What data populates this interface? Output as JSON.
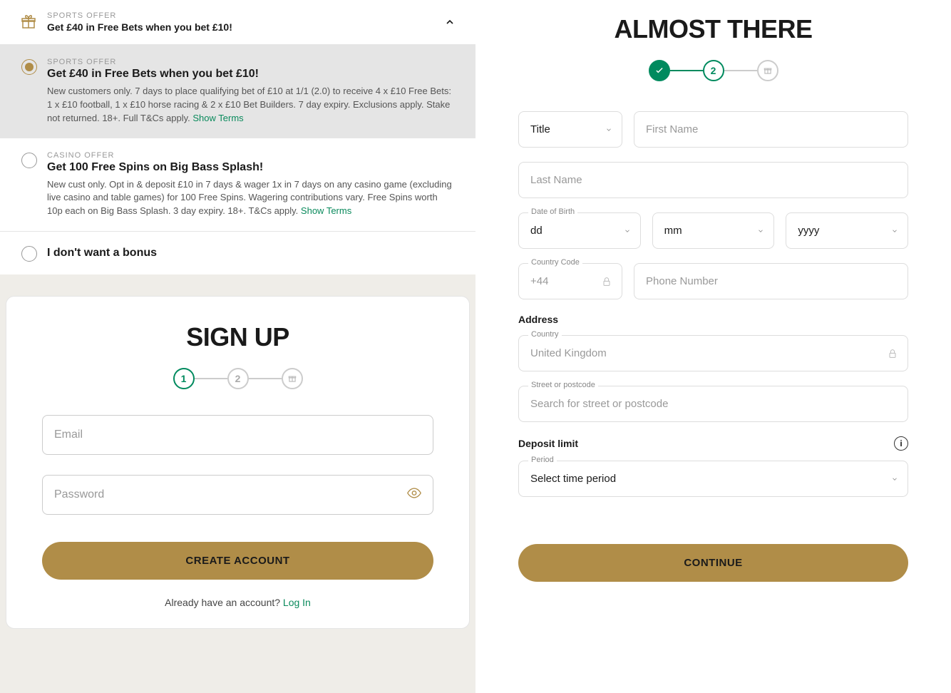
{
  "offers": {
    "header_cat": "SPORTS OFFER",
    "header_title": "Get £40 in Free Bets when you bet £10!",
    "sports": {
      "cat": "SPORTS OFFER",
      "title": "Get £40 in Free Bets when you bet £10!",
      "desc": "New customers only. 7 days to place qualifying bet of £10 at 1/1 (2.0) to receive 4 x £10 Free Bets: 1 x £10 football, 1 x £10 horse racing & 2 x £10 Bet Builders. 7 day expiry. Exclusions apply. Stake not returned. 18+. Full T&Cs apply.",
      "show_terms": "Show Terms"
    },
    "casino": {
      "cat": "CASINO OFFER",
      "title": "Get 100 Free Spins on Big Bass Splash!",
      "desc": "New cust only. Opt in & deposit £10 in 7 days & wager 1x in 7 days on any casino game (excluding live casino and table games) for 100 Free Spins. Wagering contributions vary. Free Spins worth 10p each on Big Bass Splash. 3 day expiry. 18+. T&Cs apply.",
      "show_terms": "Show Terms"
    },
    "none": "I don't want a bonus"
  },
  "signup": {
    "title": "SIGN UP",
    "step1": "1",
    "step2": "2",
    "email_ph": "Email",
    "password_ph": "Password",
    "create_btn": "CREATE ACCOUNT",
    "already": "Already have an account? ",
    "login": "Log In"
  },
  "right": {
    "title": "ALMOST THERE",
    "step2": "2",
    "title_sel": "Title",
    "first_ph": "First Name",
    "last_ph": "Last Name",
    "dob_label": "Date of Birth",
    "dd": "dd",
    "mm": "mm",
    "yyyy": "yyyy",
    "cc_label": "Country Code",
    "cc_val": "+44",
    "phone_ph": "Phone Number",
    "address_label": "Address",
    "country_label": "Country",
    "country_val": "United Kingdom",
    "street_label": "Street or postcode",
    "street_ph": "Search for street or postcode",
    "deposit_label": "Deposit limit",
    "period_label": "Period",
    "period_val": "Select time period",
    "continue_btn": "CONTINUE"
  }
}
